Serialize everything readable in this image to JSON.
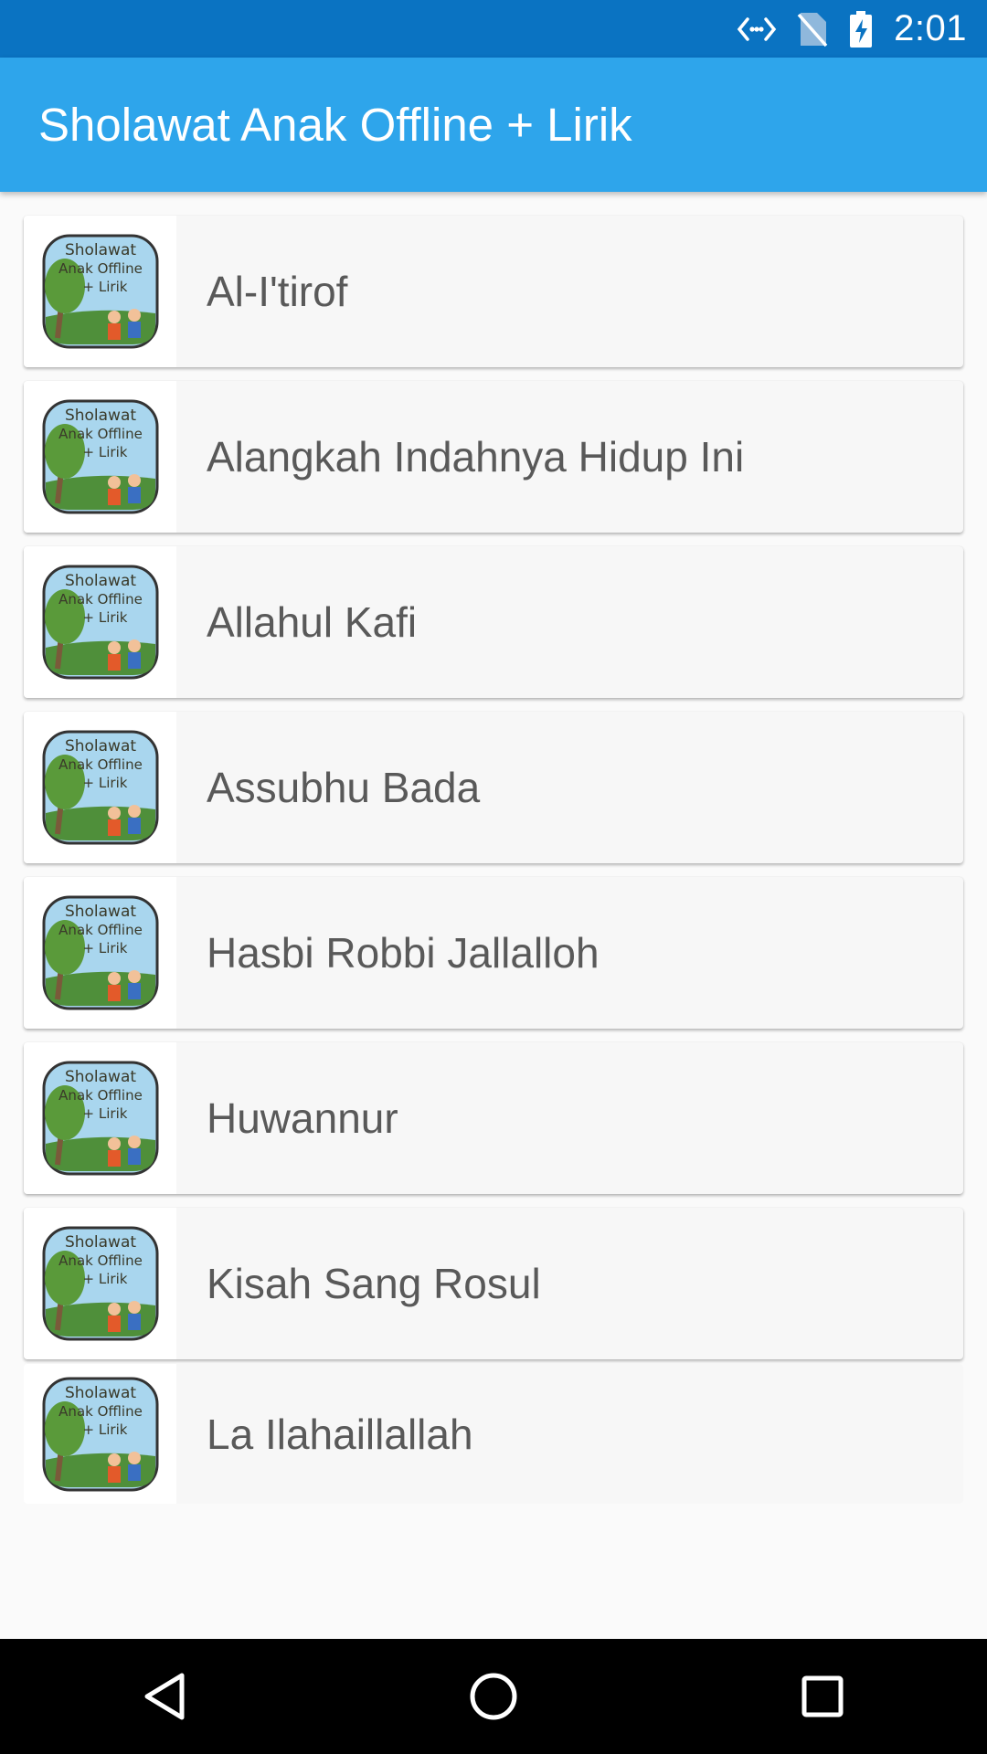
{
  "status_bar": {
    "time": "2:01",
    "icons": [
      "data-transfer-icon",
      "no-sim-icon",
      "battery-charging-icon"
    ]
  },
  "app_bar": {
    "title": "Sholawat Anak Offline + Lirik"
  },
  "thumbnail": {
    "lines": [
      "Sholawat",
      "Anak Offline",
      "+ Lirik"
    ]
  },
  "songs": [
    {
      "title": "Al-I'tirof"
    },
    {
      "title": "Alangkah Indahnya Hidup Ini"
    },
    {
      "title": "Allahul Kafi"
    },
    {
      "title": "Assubhu Bada"
    },
    {
      "title": "Hasbi Robbi Jallalloh"
    },
    {
      "title": "Huwannur"
    },
    {
      "title": "Kisah Sang Rosul"
    },
    {
      "title": "La Ilahaillallah"
    }
  ],
  "nav_bar": {
    "buttons": [
      "back-icon",
      "home-icon",
      "recents-icon"
    ]
  },
  "colors": {
    "status_bar": "#0a73c2",
    "app_bar": "#2ea5eb",
    "background": "#fafafa",
    "text": "#595959"
  }
}
